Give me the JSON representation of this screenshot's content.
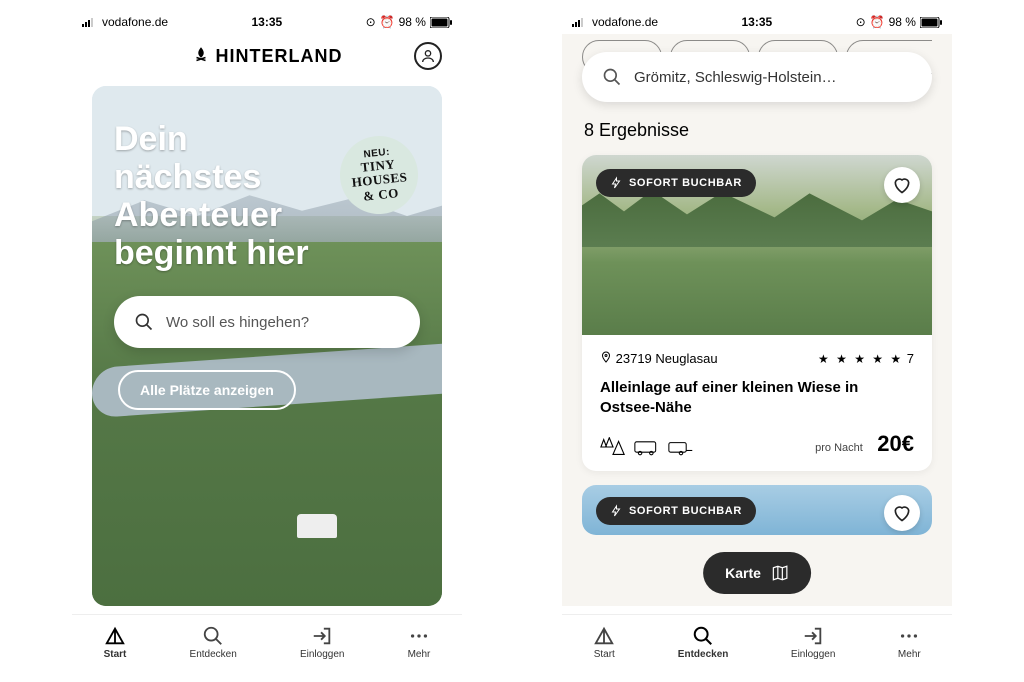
{
  "status": {
    "carrier": "vodafone.de",
    "time": "13:35",
    "battery": "98 %"
  },
  "screen_home": {
    "brand": "HINTERLAND",
    "hero_title": "Dein nächstes Abenteuer beginnt hier",
    "tiny_badge": {
      "line0": "NEU:",
      "line1": "TINY",
      "line2": "HOUSES",
      "line3": "& CO"
    },
    "search_placeholder": "Wo soll es hingehen?",
    "all_places_label": "Alle Plätze anzeigen"
  },
  "screen_results": {
    "search_value": "Grömitz, Schleswig-Holstein…",
    "results_count": "8 Ergebnisse",
    "card1": {
      "badge": "SOFORT BUCHBAR",
      "location": "23719 Neuglasau",
      "rating_count": "7",
      "title": "Alleinlage auf einer kleinen Wiese in Ostsee-Nähe",
      "price_label": "pro Nacht",
      "price": "20€"
    },
    "card2": {
      "badge": "SOFORT BUCHBAR"
    },
    "map_button": "Karte"
  },
  "nav": {
    "start": "Start",
    "entdecken": "Entdecken",
    "einloggen": "Einloggen",
    "mehr": "Mehr"
  }
}
